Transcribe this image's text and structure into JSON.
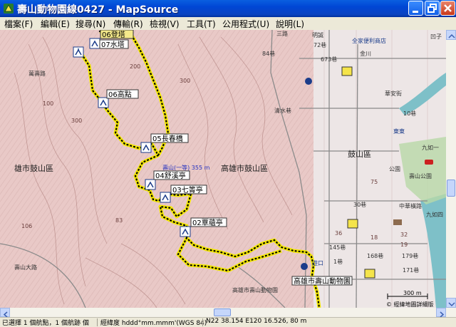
{
  "window": {
    "title": "壽山動物園線0427 - MapSource"
  },
  "menu": [
    {
      "label": "檔案(F)"
    },
    {
      "label": "編輯(E)"
    },
    {
      "label": "搜尋(N)"
    },
    {
      "label": "傳輸(R)"
    },
    {
      "label": "檢視(V)"
    },
    {
      "label": "工具(T)"
    },
    {
      "label": "公用程式(U)"
    },
    {
      "label": "說明(L)"
    }
  ],
  "map": {
    "waypoints": {
      "wp06": "06登塔",
      "wp07": "07水塔",
      "wp06b": "06高點",
      "wp05": "05長春橋",
      "wp04": "04舒溪亭",
      "wp03": "03七箐亭",
      "wp02": "02覃蘊亭",
      "zoo": "高雄市壽山動物園",
      "shoushan": "壽山(一等) 355 m"
    },
    "district_labels": {
      "left": "雄市鼓山區",
      "center": "高雄市鼓山區",
      "right": "鼓山區"
    },
    "streets": [
      "72巷",
      "673巷",
      "84巷",
      "清水巷",
      "金川",
      "華安街",
      "九如一",
      "九如四",
      "明誠",
      "三路",
      "中華橫路",
      "145巷",
      "168巷",
      "179巷",
      "171巷",
      "10巷",
      "30巷",
      "1巷",
      "壽山大路",
      "萬壽路",
      "凹子",
      "公園"
    ],
    "elevations": [
      "200",
      "300",
      "106",
      "100",
      "83",
      "75",
      "18",
      "32",
      "19",
      "36",
      "300"
    ],
    "poi": {
      "convenience": "全家便利商店",
      "park": "壽山公園",
      "gate": "東東",
      "entrance": "遊口",
      "zoo_small": "高雄市壽山動物園"
    },
    "scale": "300 m",
    "copyright": "© 經緯地圖詳細版"
  },
  "status": {
    "selection": "已選擇 1 個航點，1 個航跡 個",
    "coord_format": "經緯度 hddd°mm.mmm'(WGS 84)",
    "position": "N22 38.154 E120 16.526, 80 m"
  },
  "colors": {
    "title_bar": "#0046d5",
    "terrain": "#e8c8c6",
    "track": "#f2e600",
    "road": "#808080",
    "water": "#7ec0c8"
  }
}
